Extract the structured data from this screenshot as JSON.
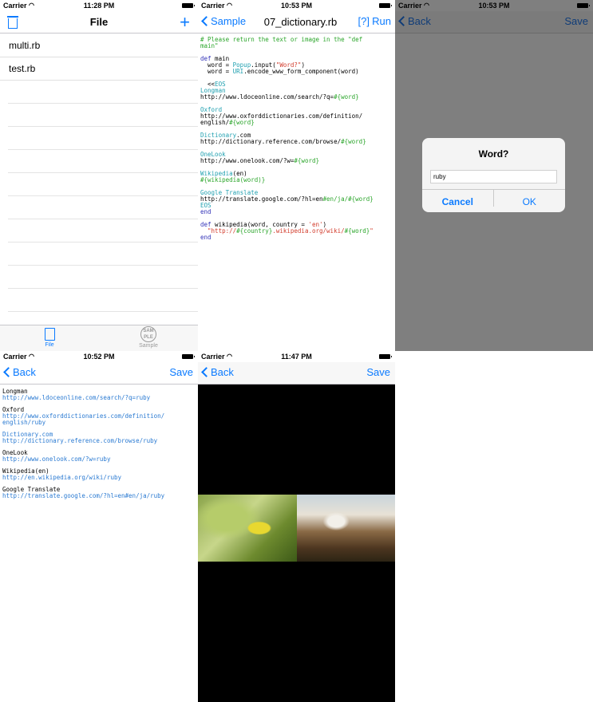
{
  "status": {
    "carrier": "Carrier",
    "p1_time": "11:28 PM",
    "p2_time": "10:53 PM",
    "p3_time": "10:53 PM",
    "p4_time": "10:52 PM",
    "p5_time": "11:47 PM"
  },
  "files": {
    "title": "File",
    "items": [
      "multi.rb",
      "test.rb"
    ],
    "tabs": [
      {
        "label": "File"
      },
      {
        "label": "Sample"
      }
    ],
    "sample_icon_text": "SAM PLE"
  },
  "editor": {
    "back_label": "Sample",
    "title": "07_dictionary.rb",
    "help_label": "[?]",
    "run_label": "Run"
  },
  "dialog_screen": {
    "back_label": "Back",
    "save_label": "Save",
    "dialog_title": "Word?",
    "input_value": "ruby",
    "cancel_label": "Cancel",
    "ok_label": "OK"
  },
  "output_screen": {
    "back_label": "Back",
    "save_label": "Save",
    "entries": [
      {
        "name": "Longman",
        "url": "http://www.ldoceonline.com/search/?q=ruby"
      },
      {
        "name": "Oxford",
        "url": "http://www.oxforddictionaries.com/definition/\nenglish/ruby"
      },
      {
        "name": "Dictionary.com",
        "url": "http://dictionary.reference.com/browse/ruby"
      },
      {
        "name": "OneLook",
        "url": "http://www.onelook.com/?w=ruby"
      },
      {
        "name": "Wikipedia(en)",
        "url": "http://en.wikipedia.org/wiki/ruby"
      },
      {
        "name": "Google Translate",
        "url": "http://translate.google.com/?hl=en#en/ja/ruby"
      }
    ]
  },
  "image_screen": {
    "back_label": "Back",
    "save_label": "Save"
  }
}
